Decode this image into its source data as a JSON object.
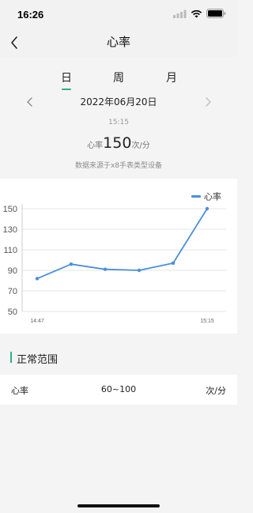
{
  "status_bar": {
    "time": "16:26"
  },
  "nav": {
    "title": "心率",
    "back_icon": "chevron-left-icon"
  },
  "tabs": [
    {
      "label": "日",
      "active": true
    },
    {
      "label": "周",
      "active": false
    },
    {
      "label": "月",
      "active": false
    }
  ],
  "date": {
    "text": "2022年06月20日"
  },
  "reading": {
    "time": "15:15",
    "prefix": "心率",
    "value": "150",
    "unit": "次/分",
    "source": "数据来源于x8手表类型设备"
  },
  "colors": {
    "accent": "#2db08d",
    "line": "#4a8fd9"
  },
  "chart_data": {
    "type": "line",
    "series": [
      {
        "name": "心率",
        "values": [
          82,
          96,
          91,
          90,
          97,
          150
        ]
      }
    ],
    "x_tick_labels": [
      "14:47",
      "15:15"
    ],
    "y_ticks": [
      50,
      70,
      90,
      110,
      130,
      150
    ],
    "ylim": [
      50,
      150
    ],
    "legend_position": "top-right",
    "grid": true
  },
  "normal_range": {
    "title": "正常范围",
    "name": "心率",
    "value": "60~100",
    "unit": "次/分"
  }
}
